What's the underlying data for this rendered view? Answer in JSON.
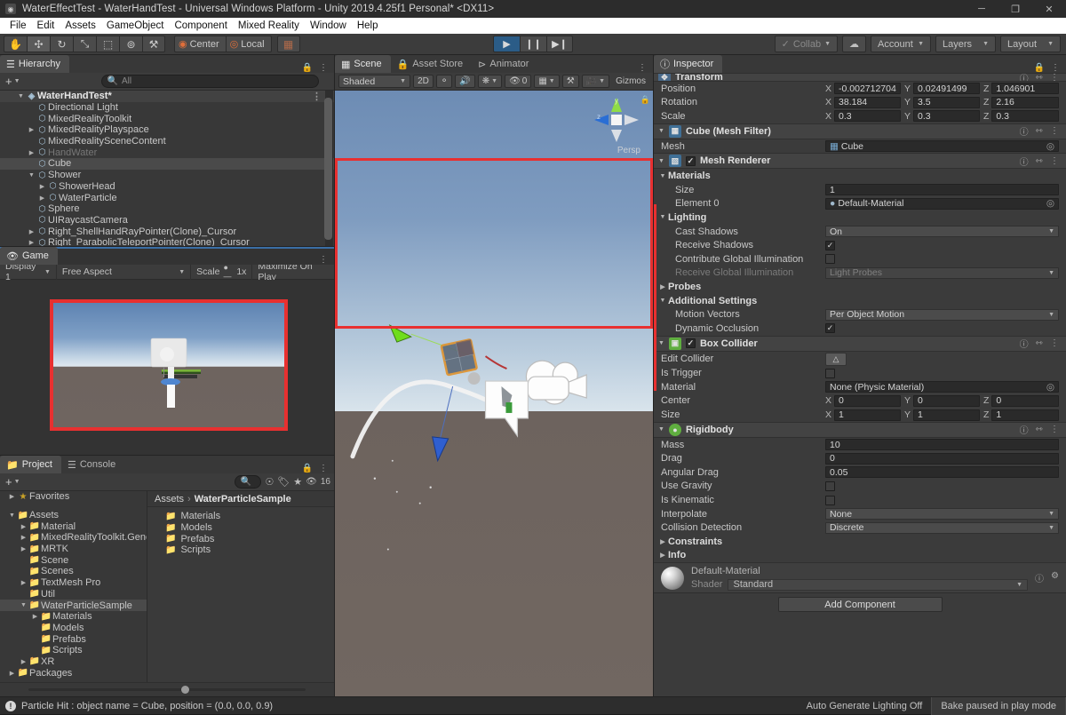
{
  "window": {
    "title": "WaterEffectTest - WaterHandTest - Universal Windows Platform - Unity 2019.4.25f1 Personal* <DX11>",
    "minimize": "─",
    "maximize": "❐",
    "close": "✕"
  },
  "menu": [
    "File",
    "Edit",
    "Assets",
    "GameObject",
    "Component",
    "Mixed Reality",
    "Window",
    "Help"
  ],
  "toolbar": {
    "tools": [
      {
        "name": "hand-tool",
        "glyph": "✋",
        "active": false
      },
      {
        "name": "move-tool",
        "glyph": "✣",
        "active": true
      },
      {
        "name": "rotate-tool",
        "glyph": "↻",
        "active": false
      },
      {
        "name": "scale-tool",
        "glyph": "⤡",
        "active": false
      },
      {
        "name": "rect-tool",
        "glyph": "⬚",
        "active": false
      },
      {
        "name": "transform-tool",
        "glyph": "⊚",
        "active": false
      },
      {
        "name": "custom-tool",
        "glyph": "⚒",
        "active": false
      }
    ],
    "pivot_label": "Center",
    "space_label": "Local",
    "play": "▶",
    "pause": "❙❙",
    "step": "▶❙",
    "play_active": true,
    "collab": "Collab",
    "cloud_icon": "☁",
    "account": "Account",
    "layers": "Layers",
    "layout": "Layout"
  },
  "hierarchy": {
    "tab": "Hierarchy",
    "search_placeholder": "All",
    "plus": "+",
    "items": [
      {
        "label": "WaterHandTest*",
        "depth": 0,
        "arrow": "down",
        "kind": "scene",
        "selected": false,
        "dim": false
      },
      {
        "label": "Directional Light",
        "depth": 1,
        "arrow": "none",
        "kind": "go",
        "selected": false,
        "dim": false
      },
      {
        "label": "MixedRealityToolkit",
        "depth": 1,
        "arrow": "none",
        "kind": "go",
        "selected": false,
        "dim": false
      },
      {
        "label": "MixedRealityPlayspace",
        "depth": 1,
        "arrow": "right",
        "kind": "go",
        "selected": false,
        "dim": false
      },
      {
        "label": "MixedRealitySceneContent",
        "depth": 1,
        "arrow": "none",
        "kind": "go",
        "selected": false,
        "dim": false
      },
      {
        "label": "HandWater",
        "depth": 1,
        "arrow": "right",
        "kind": "go",
        "selected": false,
        "dim": true
      },
      {
        "label": "Cube",
        "depth": 1,
        "arrow": "none",
        "kind": "go",
        "selected": true,
        "dim": false
      },
      {
        "label": "Shower",
        "depth": 1,
        "arrow": "down",
        "kind": "go",
        "selected": false,
        "dim": false
      },
      {
        "label": "ShowerHead",
        "depth": 2,
        "arrow": "right",
        "kind": "go",
        "selected": false,
        "dim": false
      },
      {
        "label": "WaterParticle",
        "depth": 2,
        "arrow": "right",
        "kind": "go",
        "selected": false,
        "dim": false
      },
      {
        "label": "Sphere",
        "depth": 1,
        "arrow": "none",
        "kind": "go",
        "selected": false,
        "dim": false
      },
      {
        "label": "UIRaycastCamera",
        "depth": 1,
        "arrow": "none",
        "kind": "go",
        "selected": false,
        "dim": false
      },
      {
        "label": "Right_ShellHandRayPointer(Clone)_Cursor",
        "depth": 1,
        "arrow": "right",
        "kind": "go",
        "selected": false,
        "dim": false
      },
      {
        "label": "Right_ParabolicTeleportPointer(Clone)_Cursor",
        "depth": 1,
        "arrow": "right",
        "kind": "go",
        "selected": false,
        "dim": false
      }
    ]
  },
  "game": {
    "tab": "Game",
    "display": "Display 1",
    "aspect": "Free Aspect",
    "scale_label": "Scale",
    "scale_value": "1x",
    "maximize": "Maximize On Play"
  },
  "scene": {
    "tabs": [
      "Scene",
      "Asset Store",
      "Animator"
    ],
    "active_tab": "Scene",
    "draw_mode": "Shaded",
    "mode_2d": "2D",
    "light_icon": "Ὂ1",
    "audio_icon": "◂))",
    "fx_icon": "✦",
    "hidden_count": "0",
    "gizmos": "Gizmos",
    "persp_label": "Persp",
    "axis_y": "y",
    "axis_z": "z"
  },
  "project": {
    "tabs": [
      "Project",
      "Console"
    ],
    "active_tab": "Project",
    "plus": "+",
    "search_placeholder": "",
    "hidden_count": "16",
    "breadcrumb": [
      "Assets",
      "WaterParticleSample"
    ],
    "tree": [
      {
        "label": "Favorites",
        "depth": 0,
        "arrow": "right",
        "icon": "star",
        "selected": false
      },
      {
        "label": "",
        "depth": 0,
        "arrow": "none",
        "icon": "none",
        "selected": false
      },
      {
        "label": "Assets",
        "depth": 0,
        "arrow": "down",
        "icon": "folder-open",
        "selected": false
      },
      {
        "label": "Material",
        "depth": 1,
        "arrow": "right",
        "icon": "folder",
        "selected": false
      },
      {
        "label": "MixedRealityToolkit.Genera",
        "depth": 1,
        "arrow": "right",
        "icon": "folder",
        "selected": false
      },
      {
        "label": "MRTK",
        "depth": 1,
        "arrow": "right",
        "icon": "folder",
        "selected": false
      },
      {
        "label": "Scene",
        "depth": 1,
        "arrow": "none",
        "icon": "folder",
        "selected": false
      },
      {
        "label": "Scenes",
        "depth": 1,
        "arrow": "none",
        "icon": "folder",
        "selected": false
      },
      {
        "label": "TextMesh Pro",
        "depth": 1,
        "arrow": "right",
        "icon": "folder",
        "selected": false
      },
      {
        "label": "Util",
        "depth": 1,
        "arrow": "none",
        "icon": "folder",
        "selected": false
      },
      {
        "label": "WaterParticleSample",
        "depth": 1,
        "arrow": "down",
        "icon": "folder-open",
        "selected": true
      },
      {
        "label": "Materials",
        "depth": 2,
        "arrow": "right",
        "icon": "folder",
        "selected": false
      },
      {
        "label": "Models",
        "depth": 2,
        "arrow": "none",
        "icon": "folder",
        "selected": false
      },
      {
        "label": "Prefabs",
        "depth": 2,
        "arrow": "none",
        "icon": "folder",
        "selected": false
      },
      {
        "label": "Scripts",
        "depth": 2,
        "arrow": "none",
        "icon": "folder",
        "selected": false
      },
      {
        "label": "XR",
        "depth": 1,
        "arrow": "right",
        "icon": "folder",
        "selected": false
      },
      {
        "label": "Packages",
        "depth": 0,
        "arrow": "right",
        "icon": "folder",
        "selected": false
      }
    ],
    "assets": [
      "Materials",
      "Models",
      "Prefabs",
      "Scripts"
    ]
  },
  "inspector": {
    "tab": "Inspector",
    "transform": {
      "title": "Transform",
      "rows": [
        {
          "label": "Position",
          "x": "-0.002712704",
          "y": "0.02491499",
          "z": "1.046901"
        },
        {
          "label": "Rotation",
          "x": "38.184",
          "y": "3.5",
          "z": "2.16"
        },
        {
          "label": "Scale",
          "x": "0.3",
          "y": "0.3",
          "z": "0.3"
        }
      ]
    },
    "mesh_filter": {
      "title": "Cube (Mesh Filter)",
      "mesh_label": "Mesh",
      "mesh_value": "Cube"
    },
    "mesh_renderer": {
      "title": "Mesh Renderer",
      "enabled": true,
      "materials_label": "Materials",
      "size_label": "Size",
      "size_value": "1",
      "element_label": "Element 0",
      "element_value": "Default-Material",
      "lighting_label": "Lighting",
      "cast_shadows_label": "Cast Shadows",
      "cast_shadows_value": "On",
      "receive_shadows_label": "Receive Shadows",
      "receive_shadows_checked": true,
      "contribute_gi_label": "Contribute Global Illumination",
      "contribute_gi_checked": false,
      "receive_gi_label": "Receive Global Illumination",
      "receive_gi_value": "Light Probes",
      "probes_label": "Probes",
      "additional_label": "Additional Settings",
      "motion_vectors_label": "Motion Vectors",
      "motion_vectors_value": "Per Object Motion",
      "dynamic_occlusion_label": "Dynamic Occlusion",
      "dynamic_occlusion_checked": true
    },
    "box_collider": {
      "title": "Box Collider",
      "enabled": true,
      "edit_collider_label": "Edit Collider",
      "is_trigger_label": "Is Trigger",
      "is_trigger_checked": false,
      "material_label": "Material",
      "material_value": "None (Physic Material)",
      "center_label": "Center",
      "center": {
        "x": "0",
        "y": "0",
        "z": "0"
      },
      "size_label": "Size",
      "size": {
        "x": "1",
        "y": "1",
        "z": "1"
      }
    },
    "rigidbody": {
      "title": "Rigidbody",
      "mass_label": "Mass",
      "mass_value": "10",
      "drag_label": "Drag",
      "drag_value": "0",
      "angular_drag_label": "Angular Drag",
      "angular_drag_value": "0.05",
      "use_gravity_label": "Use Gravity",
      "use_gravity_checked": false,
      "is_kinematic_label": "Is Kinematic",
      "is_kinematic_checked": false,
      "interpolate_label": "Interpolate",
      "interpolate_value": "None",
      "collision_detection_label": "Collision Detection",
      "collision_detection_value": "Discrete",
      "constraints_label": "Constraints",
      "info_label": "Info"
    },
    "material_preview": {
      "name": "Default-Material",
      "shader_label": "Shader",
      "shader_value": "Standard"
    },
    "add_component": "Add Component"
  },
  "status": {
    "message": "Particle Hit : object name = Cube, position = (0.0, 0.0, 0.9)",
    "auto_lighting": "Auto Generate Lighting Off",
    "bake_state": "Bake paused in play mode"
  },
  "colors": {
    "accent_red": "#e83030",
    "play_active": "#2b5c87",
    "panel_bg": "#383838",
    "header_bg": "#434343"
  }
}
